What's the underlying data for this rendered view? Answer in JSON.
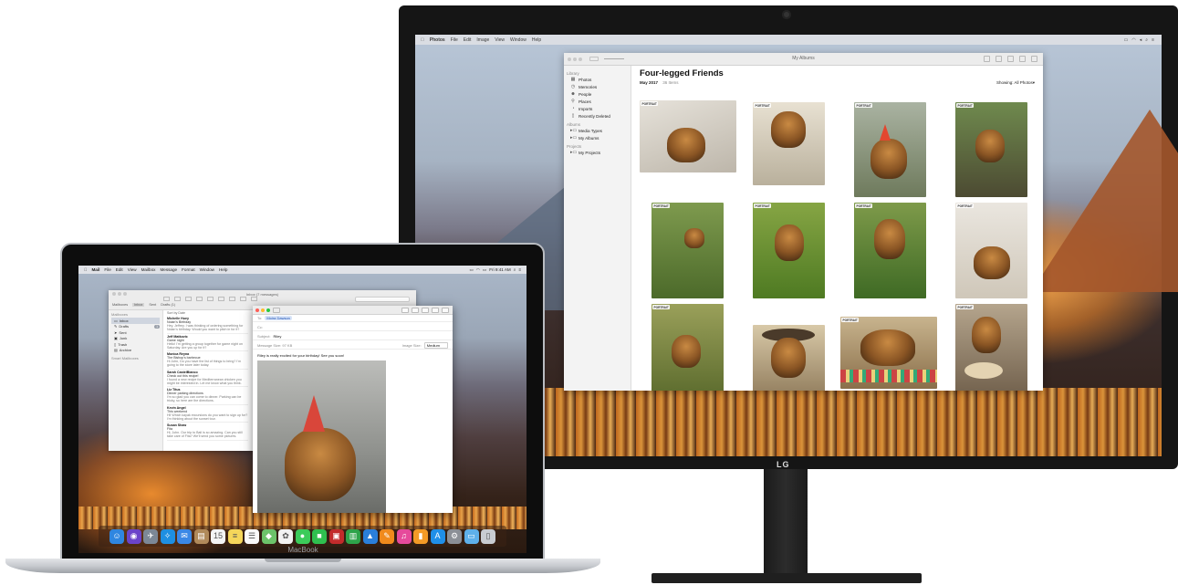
{
  "monitor": {
    "brand_label": "LG",
    "menubar": {
      "apple": "",
      "app_name": "Photos",
      "items": [
        "File",
        "Edit",
        "Image",
        "View",
        "Window",
        "Help"
      ]
    },
    "photos_window": {
      "title": "My Albums",
      "sidebar": {
        "library_header": "Library",
        "library_items": [
          {
            "label": "Photos",
            "icon": "photos-icon"
          },
          {
            "label": "Memories",
            "icon": "memories-icon"
          },
          {
            "label": "People",
            "icon": "people-icon"
          },
          {
            "label": "Places",
            "icon": "places-icon"
          },
          {
            "label": "Imports",
            "icon": "imports-icon"
          },
          {
            "label": "Recently Deleted",
            "icon": "trash-icon"
          }
        ],
        "albums_header": "Albums",
        "album_items": [
          {
            "label": "Media Types",
            "icon": "folder-icon"
          },
          {
            "label": "My Albums",
            "icon": "folder-icon"
          }
        ],
        "projects_header": "Projects",
        "project_items": [
          {
            "label": "My Projects",
            "icon": "folder-icon"
          }
        ]
      },
      "album_title": "Four-legged Friends",
      "date_label": "May 2017",
      "count_label": "36 Items",
      "showing_label": "Showing: All Photos",
      "portrait_tag": "PORTRAIT",
      "photos": [
        {
          "tag": "PORTRAIT",
          "bg": "#dcd7cf"
        },
        {
          "tag": "PORTRAIT",
          "bg": "#cfc6b6"
        },
        {
          "tag": "PORTRAIT",
          "bg": "#8fa07e"
        },
        {
          "tag": "PORTRAIT",
          "bg": "#6f6a4a"
        },
        {
          "tag": "PORTRAIT",
          "bg": "#5f7a3a"
        },
        {
          "tag": "PORTRAIT",
          "bg": "#6f8e3a"
        },
        {
          "tag": "PORTRAIT",
          "bg": "#5f7e3e"
        },
        {
          "tag": "PORTRAIT",
          "bg": "#d8d3cb"
        },
        {
          "tag": "PORTRAIT",
          "bg": "#8a8a4a"
        },
        {
          "tag": "",
          "bg": "#c9b891"
        },
        {
          "tag": "PORTRAIT",
          "bg": "#b7a68c"
        },
        {
          "tag": "PORTRAIT",
          "bg": "#9c8672"
        }
      ]
    }
  },
  "macbook": {
    "name_label": "MacBook",
    "menubar": {
      "app_name": "Mail",
      "items": [
        "File",
        "Edit",
        "View",
        "Mailbox",
        "Message",
        "Format",
        "Window",
        "Help"
      ],
      "clock": "Fri 9:41 AM"
    },
    "mail": {
      "title": "Inbox (7 messages)",
      "favorites": [
        "Mailboxes",
        "Inbox",
        "Sent",
        "Drafts (1)"
      ],
      "sidebar_header": "Mailboxes",
      "sidebar_items": [
        {
          "label": "Inbox",
          "badge": "",
          "selected": true
        },
        {
          "label": "Drafts",
          "badge": "1",
          "selected": false
        },
        {
          "label": "Sent",
          "badge": "",
          "selected": false
        },
        {
          "label": "Junk",
          "badge": "",
          "selected": false
        },
        {
          "label": "Trash",
          "badge": "",
          "selected": false
        },
        {
          "label": "Archive",
          "badge": "",
          "selected": false
        }
      ],
      "smart_header": "Smart Mailboxes",
      "sort_label": "Sort by Date",
      "messages": [
        {
          "from": "Michelle Huey",
          "subject": "Nolan's Birthday",
          "preview": "Hey, Jeffrey. I was thinking of ordering something for Nolan's birthday. Would you want to pitch in for it?"
        },
        {
          "from": "Jeff Matkovic",
          "subject": "Game night",
          "preview": "Hello! I'm getting a group together for game night on Saturday. Are you up for it?"
        },
        {
          "from": "Monica Reyna",
          "subject": "The Bishop's barbecue",
          "preview": "Hi John, Do you have the list of things to bring? I'm going to the store later today."
        },
        {
          "from": "Sarah CastelBianco",
          "subject": "Check out this recipe!",
          "preview": "I found a new recipe for Mediterranean chicken you might be interested in. Let me know what you think."
        },
        {
          "from": "Liz Titus",
          "subject": "Dinner parking directions",
          "preview": "I'm so glad you can come to dinner. Parking can be tricky, so here are the directions."
        },
        {
          "from": "Kevin Angel",
          "subject": "This weekend",
          "preview": "Hi! Which kayak excursions do you want to sign up for? I'm thinking about the sunset tour."
        },
        {
          "from": "Susan Shaw",
          "subject": "Fita",
          "preview": "Hi, John. Our trip to Bali is so amazing. Can you still take care of Fita? We'll send you some pictures."
        }
      ]
    },
    "compose": {
      "to_label": "To:",
      "to_value": "Moira Dawson",
      "cc_label": "Cc:",
      "subject_label": "Subject:",
      "subject_value": "Riley",
      "size_label": "Message Size: 97 KB",
      "image_size_label": "Image Size:",
      "image_size_value": "Medium",
      "body": "Riley is really excited for your birthday! See you soon!"
    },
    "dock": [
      {
        "name": "finder-icon",
        "glyph": "☺",
        "color": "#2f86e0"
      },
      {
        "name": "siri-icon",
        "glyph": "◉",
        "color": "#6b44c9"
      },
      {
        "name": "launchpad-icon",
        "glyph": "✈",
        "color": "#7c8896"
      },
      {
        "name": "safari-icon",
        "glyph": "✧",
        "color": "#1e8fe1"
      },
      {
        "name": "mail-icon",
        "glyph": "✉",
        "color": "#3a88e6"
      },
      {
        "name": "contacts-icon",
        "glyph": "▤",
        "color": "#b08a5a"
      },
      {
        "name": "calendar-icon",
        "glyph": "15",
        "color": "#f4f4f4"
      },
      {
        "name": "notes-icon",
        "glyph": "≡",
        "color": "#f5d65a"
      },
      {
        "name": "reminders-icon",
        "glyph": "☰",
        "color": "#fafafa"
      },
      {
        "name": "maps-icon",
        "glyph": "◆",
        "color": "#6cc36a"
      },
      {
        "name": "photos-icon",
        "glyph": "✿",
        "color": "#f2f2f2"
      },
      {
        "name": "messages-icon",
        "glyph": "●",
        "color": "#3ccb5a"
      },
      {
        "name": "facetime-icon",
        "glyph": "■",
        "color": "#2fbf4f"
      },
      {
        "name": "photo-booth-icon",
        "glyph": "▣",
        "color": "#c22b2b"
      },
      {
        "name": "numbers-icon",
        "glyph": "▥",
        "color": "#2ea34a"
      },
      {
        "name": "keynote-icon",
        "glyph": "▲",
        "color": "#2a7fdb"
      },
      {
        "name": "pages-icon",
        "glyph": "✎",
        "color": "#f08a1c"
      },
      {
        "name": "itunes-icon",
        "glyph": "♫",
        "color": "#e64a9b"
      },
      {
        "name": "ibooks-icon",
        "glyph": "▮",
        "color": "#f39a26"
      },
      {
        "name": "app-store-icon",
        "glyph": "A",
        "color": "#1f8fe8"
      },
      {
        "name": "system-preferences-icon",
        "glyph": "⚙",
        "color": "#8b8f96"
      },
      {
        "name": "downloads-folder-icon",
        "glyph": "▭",
        "color": "#5eb0ea"
      },
      {
        "name": "trash-icon",
        "glyph": "▯",
        "color": "#c8ccd1"
      }
    ]
  }
}
